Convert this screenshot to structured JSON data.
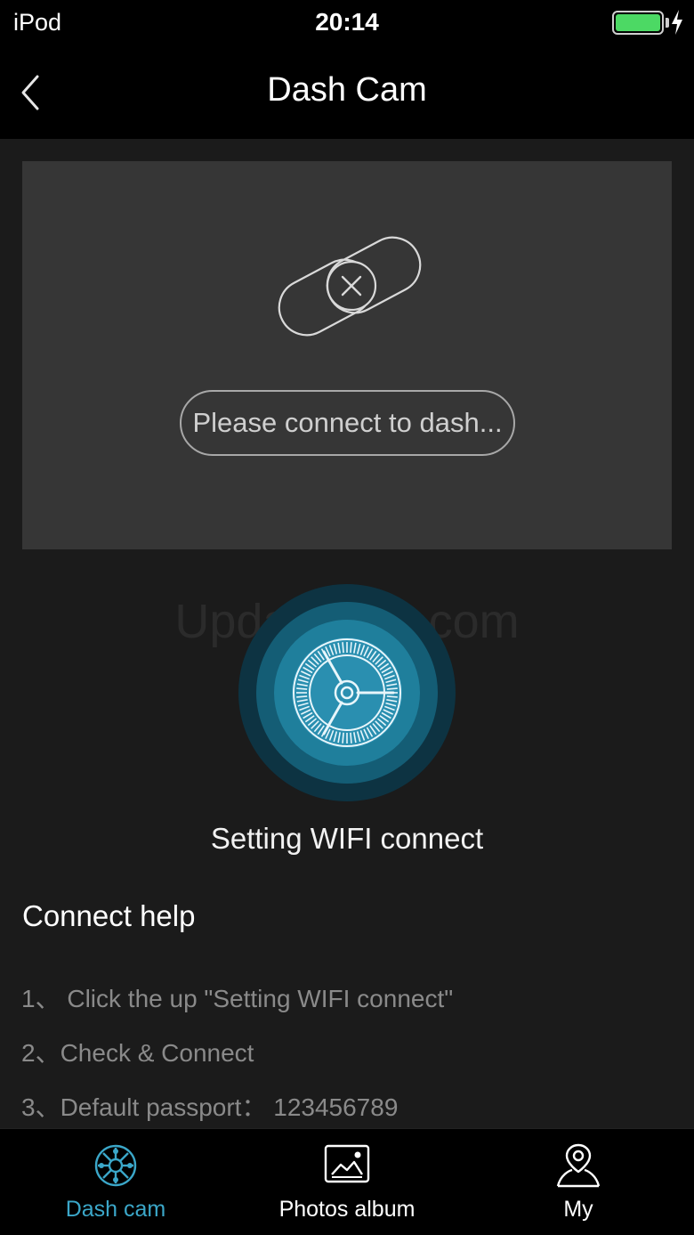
{
  "status_bar": {
    "carrier": "iPod",
    "time": "20:14",
    "battery_level": 1.0,
    "battery_color": "#4cd964",
    "charging_icon": "bolt-icon"
  },
  "nav": {
    "back_icon": "chevron-left-icon",
    "title": "Dash Cam"
  },
  "preview": {
    "icon": "disconnected-link-icon",
    "status_text": "Please connect to dash..."
  },
  "watermark": "UpdateStar.com",
  "wifi_button": {
    "icon": "wifi-setting-dial-icon",
    "label": "Setting WIFI connect",
    "accent_color": "#2a8fb0"
  },
  "help": {
    "title": "Connect help",
    "steps": [
      "1、 Click the up \"Setting WIFI connect\"",
      "2、Check & Connect",
      "3、Default passport： 123456789"
    ]
  },
  "tabs": [
    {
      "label": "Dash cam",
      "icon": "dashcam-icon",
      "active": true,
      "color": "#3ba7c9"
    },
    {
      "label": "Photos album",
      "icon": "photo-album-icon",
      "active": false,
      "color": "#ffffff"
    },
    {
      "label": "My",
      "icon": "profile-pin-icon",
      "active": false,
      "color": "#ffffff"
    }
  ]
}
